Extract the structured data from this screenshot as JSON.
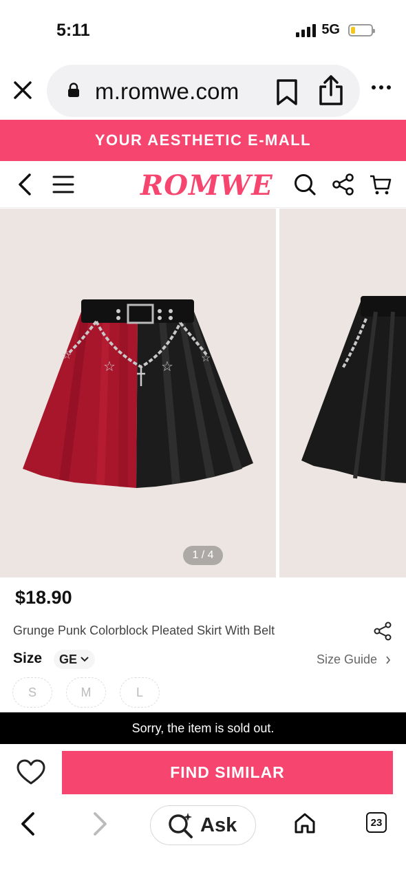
{
  "status_bar": {
    "time": "5:11",
    "network": "5G",
    "battery_level": 0.2
  },
  "browser": {
    "url": "m.romwe.com",
    "tab_count": "23",
    "ask_label": "Ask"
  },
  "banner": {
    "text": "YOUR AESTHETIC E-MALL"
  },
  "site": {
    "logo": "ROMWE",
    "brand_color": "#f6456f"
  },
  "gallery": {
    "counter": "1 / 4"
  },
  "product": {
    "price": "$18.90",
    "title": "Grunge Punk Colorblock Pleated Skirt With Belt",
    "size_label": "Size",
    "size_region": "GE",
    "size_guide": "Size Guide",
    "sizes": [
      "S",
      "M",
      "L"
    ]
  },
  "notice": {
    "sold_out": "Sorry, the item is sold out."
  },
  "actions": {
    "find_similar": "FIND SIMILAR"
  }
}
